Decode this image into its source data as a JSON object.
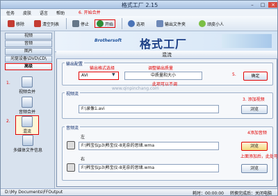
{
  "window": {
    "title": "格式工厂 2.15"
  },
  "menu": [
    "任务",
    "皮肤",
    "语言",
    "帮助"
  ],
  "toolbar": {
    "items": [
      {
        "label": "移除",
        "icon": "remove-icon",
        "color": "#c43c32"
      },
      {
        "label": "清空列表",
        "icon": "clear-list-icon",
        "color": "#c43c32"
      },
      {
        "label": "停止",
        "icon": "stop-icon",
        "color": "#667788"
      },
      {
        "label": "开始",
        "icon": "play-icon",
        "color": "#2f8b35"
      },
      {
        "label": "选项",
        "icon": "options-icon",
        "color": "#4a73b7"
      },
      {
        "label": "输出文件夹",
        "icon": "folder-icon",
        "color": "#6e89b8"
      },
      {
        "label": "顽皮小人",
        "icon": "mascot-icon",
        "color": "#7bbf45"
      }
    ]
  },
  "sidebar": {
    "tabs": [
      "视频",
      "音频",
      "图片",
      "光驱设备\\DVD\\CD\\",
      "高级"
    ],
    "items": [
      "视频合并",
      "音频合并",
      "混流",
      "多媒体文件信息"
    ]
  },
  "banner": {
    "brand": "Brothersoft",
    "title": "格式工厂"
  },
  "dialog": {
    "title": "混流",
    "output_group": "输出配置",
    "format_value": "AVI",
    "quality_value": "中质量和大小",
    "ok_label": "确定",
    "video_group": "视频流",
    "video_path": "F:\\录像1.avi",
    "browse_label": "浏览",
    "audio_group": "音频流",
    "left_label": "左",
    "left_path": "F:\\韩宝仪p3\\韩宝仪-8无奈的思绪.wma",
    "right_label": "右",
    "right_path": "F:\\韩宝仪p3\\韩宝仪-8无奈的思绪.wma"
  },
  "annotations": {
    "start_merge": "6. 开始合并",
    "format_select": "输出格式选择",
    "quality_adjust": "调整输出质量",
    "can_ignore": "此项可以不调",
    "add_video": "3. 添加视频",
    "add_audio": "4添加音频",
    "add_audio_extra": "上面添加后，此处可以不添加",
    "step1": "1.",
    "step2": "2.",
    "step5": "5."
  },
  "statusbar": {
    "path": "D:\\My Documents\\FFOutput",
    "elapsed": "耗时：00:00:00",
    "after_convert": "转换完成后：关闭电脑"
  },
  "watermark": "www.qinpinchang.com"
}
